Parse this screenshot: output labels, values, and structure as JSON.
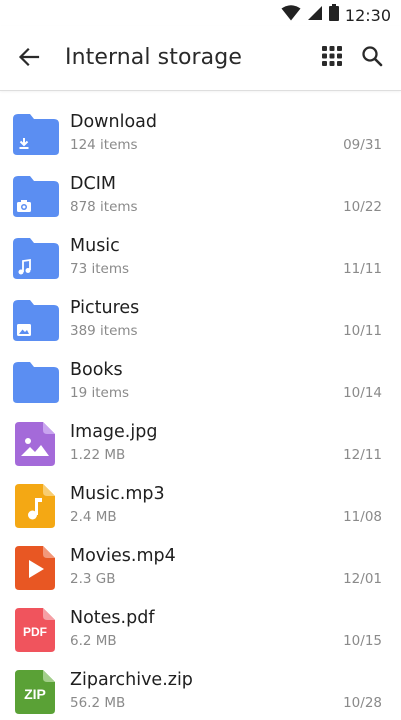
{
  "status_bar": {
    "time": "12:30"
  },
  "app_bar": {
    "title": "Internal storage"
  },
  "colors": {
    "folder": "#5b8ef2",
    "image": "#a46ad9",
    "music": "#f4a814",
    "movie": "#e85723",
    "pdf": "#f0545d",
    "zip": "#5aa136"
  },
  "files": [
    {
      "name": "Download",
      "meta": "124 items",
      "date": "09/31",
      "icon": "download-folder-icon"
    },
    {
      "name": "DCIM",
      "meta": "878 items",
      "date": "10/22",
      "icon": "camera-folder-icon"
    },
    {
      "name": "Music",
      "meta": "73 items",
      "date": "11/11",
      "icon": "music-folder-icon"
    },
    {
      "name": "Pictures",
      "meta": "389 items",
      "date": "10/11",
      "icon": "pictures-folder-icon"
    },
    {
      "name": "Books",
      "meta": "19 items",
      "date": "10/14",
      "icon": "folder-icon"
    },
    {
      "name": "Image.jpg",
      "meta": "1.22 MB",
      "date": "12/11",
      "icon": "image-file-icon"
    },
    {
      "name": "Music.mp3",
      "meta": "2.4 MB",
      "date": "11/08",
      "icon": "audio-file-icon"
    },
    {
      "name": "Movies.mp4",
      "meta": "2.3 GB",
      "date": "12/01",
      "icon": "video-file-icon"
    },
    {
      "name": "Notes.pdf",
      "meta": "6.2 MB",
      "date": "10/15",
      "icon": "pdf-file-icon",
      "badge": "PDF"
    },
    {
      "name": "Ziparchive.zip",
      "meta": "56.2 MB",
      "date": "10/28",
      "icon": "zip-file-icon",
      "badge": "ZIP"
    }
  ]
}
